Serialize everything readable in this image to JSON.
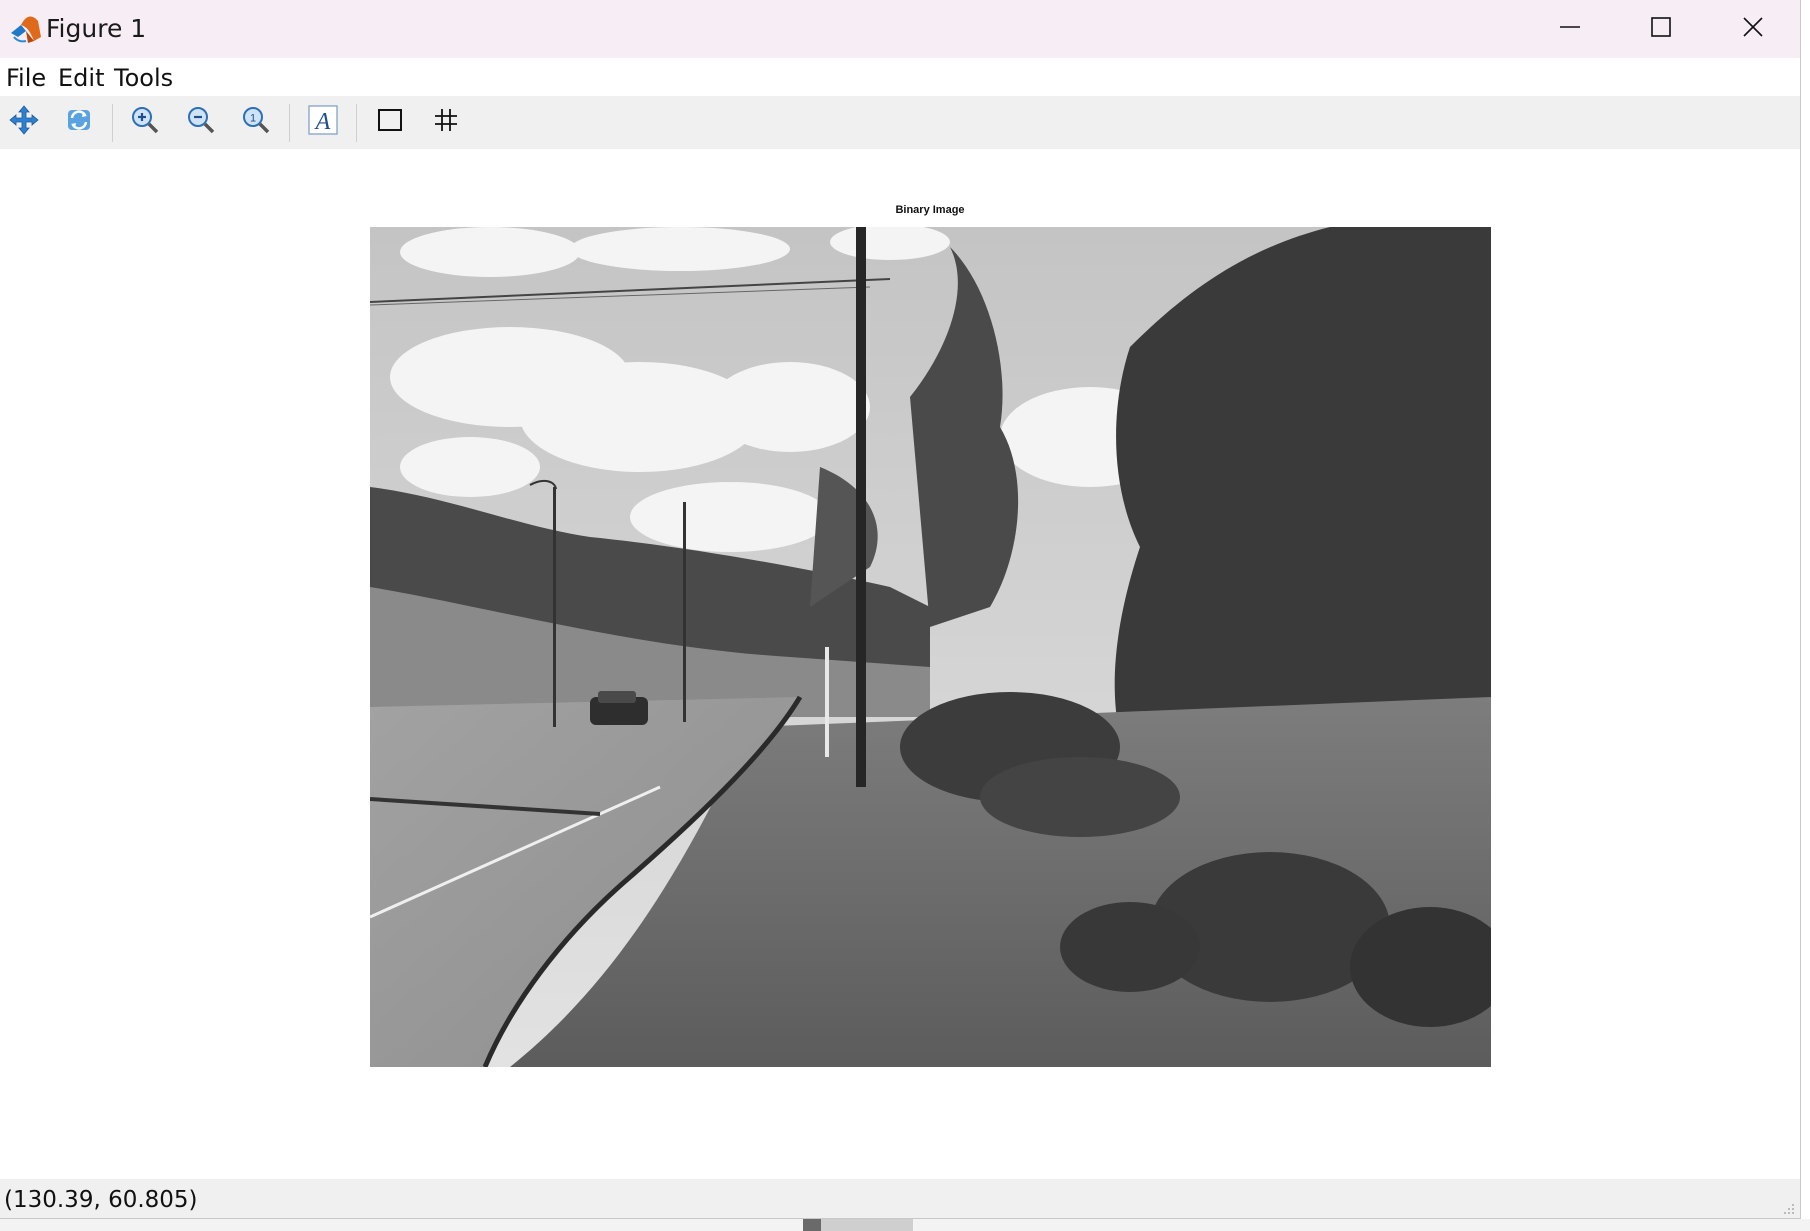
{
  "window": {
    "title": "Figure 1",
    "icons": {
      "app": "matlab-logo-icon",
      "minimize": "minimize-icon",
      "maximize": "maximize-icon",
      "close": "close-icon"
    }
  },
  "menubar": {
    "items": [
      {
        "label": "File"
      },
      {
        "label": "Edit"
      },
      {
        "label": "Tools"
      }
    ]
  },
  "toolbar": {
    "buttons": [
      {
        "icon": "pan-icon"
      },
      {
        "icon": "rotate-icon"
      },
      {
        "icon": "zoom-in-icon"
      },
      {
        "icon": "zoom-out-icon"
      },
      {
        "icon": "reset-zoom-icon"
      },
      {
        "icon": "insert-text-icon"
      },
      {
        "icon": "toggle-axes-box-icon"
      },
      {
        "icon": "toggle-grid-icon"
      }
    ]
  },
  "figure": {
    "axes_title": "Binary Image",
    "image_content": "grayscale-road-scene",
    "colors": {
      "sky": "#d9d9d9",
      "foliage": "#3a3a3a",
      "road": "#9a9a9a"
    }
  },
  "statusbar": {
    "coordinates": "(130.39, 60.805)"
  }
}
